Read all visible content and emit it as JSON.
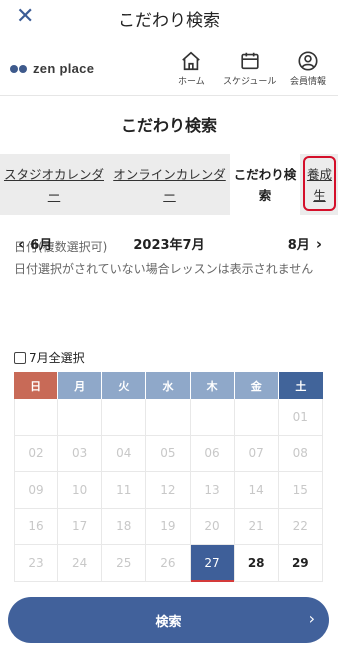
{
  "topbar": {
    "title": "こだわり検索",
    "close_icon": "close-icon"
  },
  "navbar": {
    "logo_text": "zen place",
    "items": [
      {
        "label": "ホーム",
        "icon": "home-icon"
      },
      {
        "label": "スケジュール",
        "icon": "calendar-icon"
      },
      {
        "label": "会員情報",
        "icon": "user-icon"
      }
    ]
  },
  "page_heading": "こだわり検索",
  "tabs": [
    {
      "label": "スタジオカレンダー",
      "active": false
    },
    {
      "label": "オンラインカレンダー",
      "active": false
    },
    {
      "label": "こだわり検索",
      "active": true
    },
    {
      "label": "養成生",
      "active": false,
      "highlighted": true
    }
  ],
  "filters": {
    "date_label": "日付(複数選択可)",
    "date_note": "日付選択がされていない場合レッスンは表示されません"
  },
  "month_nav": {
    "prev": "6月",
    "current": "2023年7月",
    "next": "8月"
  },
  "select_all": "7月全選択",
  "calendar": {
    "weekdays": [
      "日",
      "月",
      "火",
      "水",
      "木",
      "金",
      "土"
    ],
    "weeks": [
      [
        "",
        "",
        "",
        "",
        "",
        "",
        "01"
      ],
      [
        "02",
        "03",
        "04",
        "05",
        "06",
        "07",
        "08"
      ],
      [
        "09",
        "10",
        "11",
        "12",
        "13",
        "14",
        "15"
      ],
      [
        "16",
        "17",
        "18",
        "19",
        "20",
        "21",
        "22"
      ],
      [
        "23",
        "24",
        "25",
        "26",
        "27",
        "28",
        "29"
      ]
    ],
    "today": "27",
    "enabled_days": [
      "28",
      "29"
    ]
  },
  "search_button": "検索",
  "colors": {
    "accent": "#41619b",
    "sunday": "#c86a57",
    "saturday": "#41649a",
    "weekday": "#8fa8c9",
    "highlight": "#d40f2a"
  }
}
